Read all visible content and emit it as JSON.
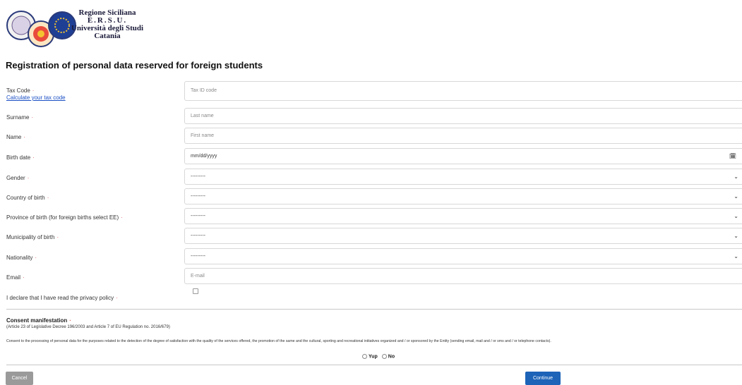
{
  "header": {
    "logo_lines": [
      "Regione Siciliana",
      "E.R.S.U.",
      "Università degli Studi",
      "Catania"
    ],
    "page_title": "Registration of personal data reserved for foreign students"
  },
  "form": {
    "tax_code": {
      "label": "Tax Code",
      "link": "Calculate your tax code",
      "placeholder": "Tax ID code"
    },
    "surname": {
      "label": "Surname",
      "placeholder": "Last name"
    },
    "name": {
      "label": "Name",
      "placeholder": "First name"
    },
    "birth_date": {
      "label": "Birth date",
      "value": "mm/dd/yyyy"
    },
    "gender": {
      "label": "Gender",
      "value": "---------"
    },
    "country_of_birth": {
      "label": "Country of birth",
      "value": "---------"
    },
    "province_of_birth": {
      "label": "Province of birth (for foreign births select EE)",
      "value": "---------"
    },
    "municipality_of_birth": {
      "label": "Municipality of birth",
      "value": "---------"
    },
    "nationality": {
      "label": "Nationality",
      "value": "---------"
    },
    "email": {
      "label": "Email",
      "placeholder": "E-mail"
    },
    "privacy": {
      "label": "I declare that I have read the privacy policy"
    },
    "required_marker": "·"
  },
  "consent": {
    "title": "Consent manifestation",
    "subtitle": "(Article 23 of Legislative Decree 196/2003 and Article 7 of EU Regulation no. 2016/679)",
    "text": "Consent to the processing of personal data for the purposes related to the detection of the degree of satisfaction with the quality of the services offered, the promotion of the same and the cultural, sporting and recreational initiatives organized and / or sponsored by the Entity (sending email, mail and / or sms and / or telephone contacts).",
    "yes_label": "Yup",
    "no_label": "No"
  },
  "buttons": {
    "cancel": "Cancel",
    "continue": "Continue"
  },
  "icons": {
    "select_caret": "chevron-down-icon",
    "calendar": "calendar-icon"
  },
  "colors": {
    "required": "#d9534f",
    "link": "#1a4fc4",
    "primary_button": "#1d63b8",
    "secondary_button": "#9a9a9a"
  }
}
